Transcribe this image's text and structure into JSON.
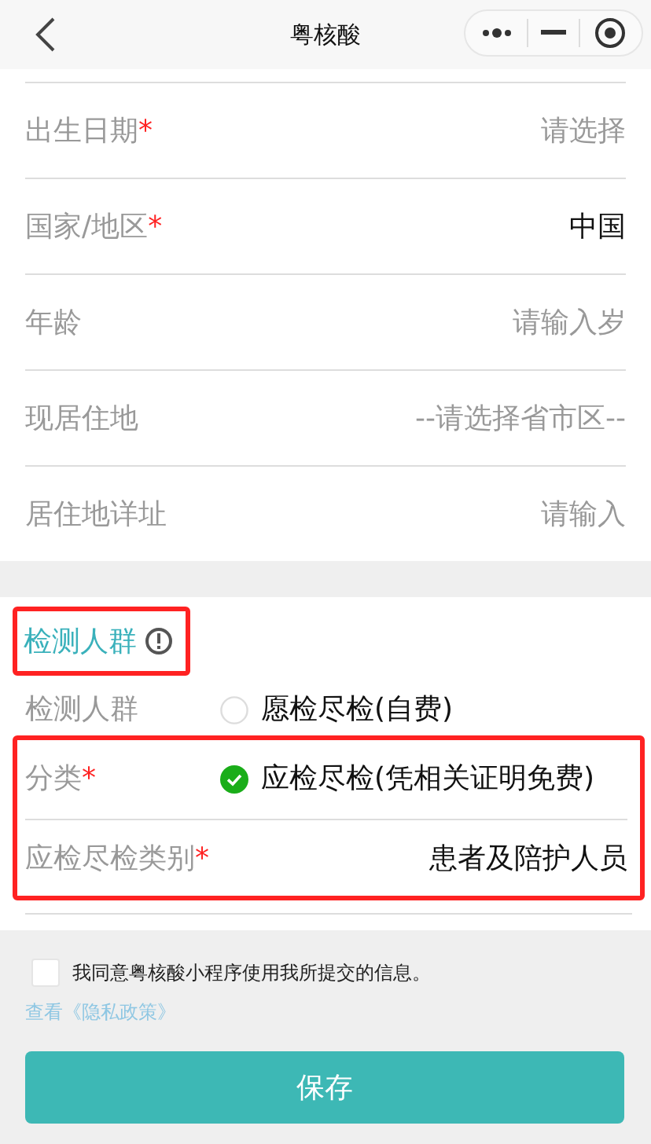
{
  "nav": {
    "title": "粤核酸"
  },
  "basic_fields": [
    {
      "label": "出生日期",
      "required_mark": "*",
      "placeholder": "请选择"
    },
    {
      "label": "国家/地区",
      "required_mark": "*",
      "value": "中国"
    },
    {
      "label": "年龄",
      "placeholder": "请输入岁"
    },
    {
      "label": "现居住地",
      "placeholder": "--请选择省市区--"
    },
    {
      "label": "居住地详址",
      "placeholder": "请输入"
    }
  ],
  "section": {
    "title": "检测人群",
    "highlighted": true,
    "groups": [
      {
        "rows": [
          {
            "kind": "radio",
            "label": "检测人群",
            "option": "愿检尽检(自费)",
            "selected": false
          }
        ]
      },
      {
        "highlighted": true,
        "rows": [
          {
            "kind": "radio",
            "label": "分类",
            "required_mark": "*",
            "option": "应检尽检(凭相关证明免费)",
            "selected": true
          },
          {
            "kind": "field",
            "label": "应检尽检类别",
            "required_mark": "*",
            "value": "患者及陪护人员"
          }
        ]
      }
    ]
  },
  "consent": {
    "text": "我同意粤核酸小程序使用我所提交的信息。",
    "checked": false,
    "link": "查看《隐私政策》"
  },
  "save_button": "保存"
}
